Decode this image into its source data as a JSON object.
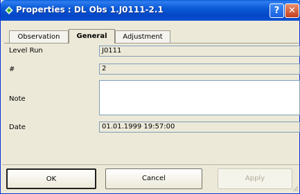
{
  "window": {
    "title": "Properties : DL Obs 1.J0111-2.1",
    "help_label": "?",
    "close_label": "✕"
  },
  "tabs": [
    {
      "label": "Observation",
      "selected": false
    },
    {
      "label": "General",
      "selected": true
    },
    {
      "label": "Adjustment",
      "selected": false
    }
  ],
  "fields": {
    "level_run": {
      "label": "Level Run",
      "value": "J0111"
    },
    "number": {
      "label": "#",
      "value": "2"
    },
    "note": {
      "label": "Note",
      "value": ""
    },
    "date": {
      "label": "Date",
      "value": "01.01.1999 19:57:00"
    }
  },
  "buttons": {
    "ok": "OK",
    "cancel": "Cancel",
    "apply": "Apply"
  },
  "colors": {
    "titlebar": "#0347c7",
    "close": "#c4401c",
    "background": "#ece9d8"
  }
}
